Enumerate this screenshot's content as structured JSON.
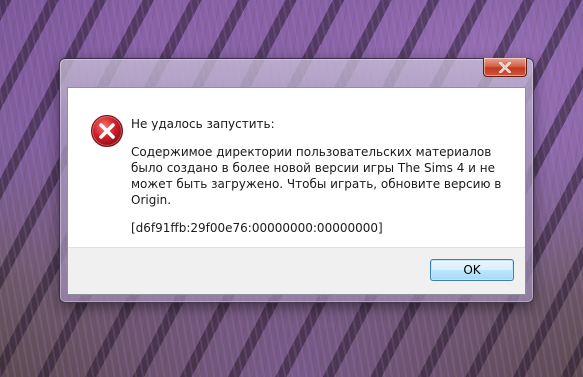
{
  "dialog": {
    "main_instruction": "Не удалось запустить:",
    "content": "Содержимое директории пользовательских материалов было создано в более новой версии игры The Sims 4 и не может быть загружено. Чтобы играть, обновите версию в Origin.",
    "error_code": "[d6f91ffb:29f00e76:00000000:00000000]",
    "ok_label": "OK",
    "icon": "error-icon",
    "close_icon": "close-icon"
  },
  "colors": {
    "close_button": "#c2391f",
    "error_icon": "#d0202a",
    "ok_border": "#3c7fb1",
    "footer": "#f0f0f0"
  }
}
